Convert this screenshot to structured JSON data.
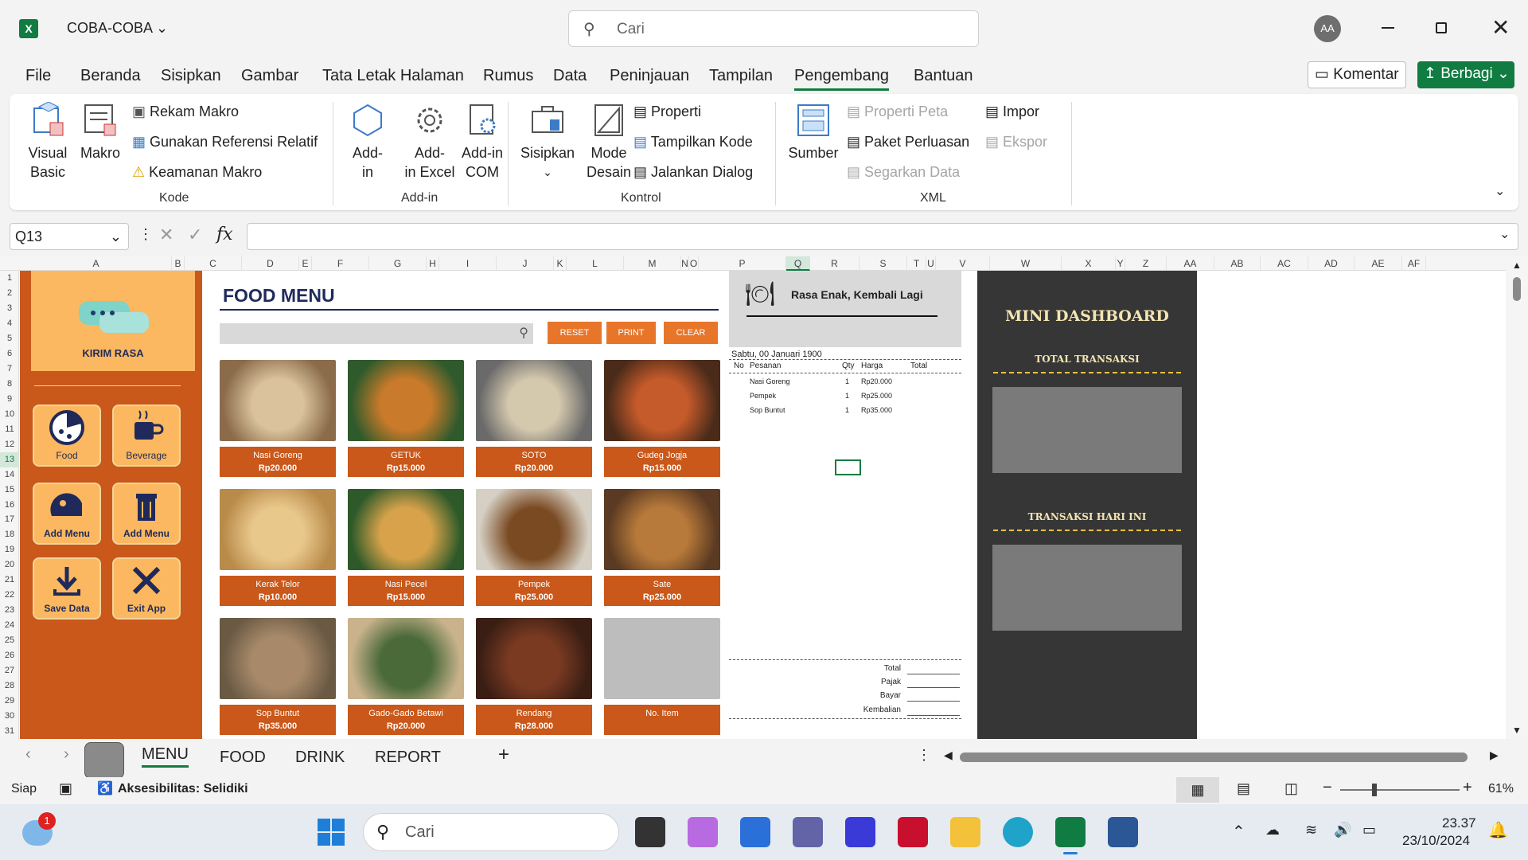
{
  "titlebar": {
    "file_name": "COBA-COBA",
    "search_placeholder": "Cari",
    "avatar": "AA"
  },
  "menu": {
    "tabs": [
      "File",
      "Beranda",
      "Sisipkan",
      "Gambar",
      "Tata Letak Halaman",
      "Rumus",
      "Data",
      "Peninjauan",
      "Tampilan",
      "Pengembang",
      "Bantuan"
    ],
    "active": "Pengembang",
    "comment_btn": "Komentar",
    "share_btn": "Berbagi"
  },
  "ribbon": {
    "kode": {
      "visual_basic": "Visual Basic",
      "visual_basic_1": "Visual",
      "visual_basic_2": "Basic",
      "makro": "Makro",
      "rekam": "Rekam Makro",
      "ref_relatif": "Gunakan Referensi Relatif",
      "keamanan": "Keamanan Makro",
      "label": "Kode"
    },
    "addin": {
      "addin": "Add-in",
      "addin_1": "Add-",
      "addin_2": "in",
      "excel_1": "Add-",
      "excel_2": "in Excel",
      "com_1": "Add-in",
      "com_2": "COM",
      "label": "Add-in"
    },
    "kontrol": {
      "sisipkan": "Sisipkan",
      "mode_1": "Mode",
      "mode_2": "Desain",
      "properti": "Properti",
      "tampilkan_kode": "Tampilkan Kode",
      "jalankan_dialog": "Jalankan Dialog",
      "label": "Kontrol"
    },
    "xml": {
      "sumber": "Sumber",
      "properti_peta": "Properti Peta",
      "paket_perluasan": "Paket Perluasan",
      "segarkan_data": "Segarkan Data",
      "impor": "Impor",
      "ekspor": "Ekspor",
      "label": "XML"
    }
  },
  "formula": {
    "cell_ref": "Q13",
    "value": ""
  },
  "columns": [
    {
      "l": "A",
      "w": 190
    },
    {
      "l": "B",
      "w": 16
    },
    {
      "l": "C",
      "w": 72
    },
    {
      "l": "D",
      "w": 72
    },
    {
      "l": "E",
      "w": 16
    },
    {
      "l": "F",
      "w": 72
    },
    {
      "l": "G",
      "w": 72
    },
    {
      "l": "H",
      "w": 16
    },
    {
      "l": "I",
      "w": 72
    },
    {
      "l": "J",
      "w": 72
    },
    {
      "l": "K",
      "w": 16
    },
    {
      "l": "L",
      "w": 72
    },
    {
      "l": "M",
      "w": 72
    },
    {
      "l": "N",
      "w": 10
    },
    {
      "l": "O",
      "w": 12
    },
    {
      "l": "P",
      "w": 110
    },
    {
      "l": "Q",
      "w": 30
    },
    {
      "l": "R",
      "w": 62
    },
    {
      "l": "S",
      "w": 60
    },
    {
      "l": "T",
      "w": 24
    },
    {
      "l": "U",
      "w": 12
    },
    {
      "l": "V",
      "w": 68
    },
    {
      "l": "W",
      "w": 90
    },
    {
      "l": "X",
      "w": 68
    },
    {
      "l": "Y",
      "w": 12
    },
    {
      "l": "Z",
      "w": 52
    },
    {
      "l": "AA",
      "w": 60
    },
    {
      "l": "AB",
      "w": 58
    },
    {
      "l": "AC",
      "w": 60
    },
    {
      "l": "AD",
      "w": 58
    },
    {
      "l": "AE",
      "w": 60
    },
    {
      "l": "AF",
      "w": 30
    }
  ],
  "rows": [
    "1",
    "2",
    "3",
    "4",
    "5",
    "6",
    "7",
    "8",
    "9",
    "10",
    "11",
    "12",
    "13",
    "14",
    "15",
    "16",
    "17",
    "18",
    "19",
    "20",
    "21",
    "22",
    "23",
    "24",
    "25",
    "26",
    "27",
    "28",
    "29",
    "30",
    "31"
  ],
  "sidebar": {
    "brand": "KIRIM RASA",
    "buttons": [
      {
        "label": "Food",
        "icon": "pizza-icon"
      },
      {
        "label": "Beverage",
        "icon": "coffee-cup-icon"
      },
      {
        "label": "Add Menu",
        "icon": "taco-icon"
      },
      {
        "label": "Add Menu",
        "icon": "trash-icon"
      },
      {
        "label": "Save Data",
        "icon": "download-icon"
      },
      {
        "label": "Exit App",
        "icon": "close-icon"
      }
    ]
  },
  "menu_panel": {
    "title": "FOOD MENU",
    "reset": "RESET",
    "print": "PRINT",
    "clear": "CLEAR"
  },
  "foods": [
    {
      "name": "Nasi Goreng",
      "price": "Rp20.000"
    },
    {
      "name": "GETUK",
      "price": "Rp15.000"
    },
    {
      "name": "SOTO",
      "price": "Rp20.000"
    },
    {
      "name": "Gudeg Jogja",
      "price": "Rp15.000"
    },
    {
      "name": "Kerak Telor",
      "price": "Rp10.000"
    },
    {
      "name": "Nasi Pecel",
      "price": "Rp15.000"
    },
    {
      "name": "Pempek",
      "price": "Rp25.000"
    },
    {
      "name": "Sate",
      "price": "Rp25.000"
    },
    {
      "name": "Sop Buntut",
      "price": "Rp35.000"
    },
    {
      "name": "Gado-Gado Betawi",
      "price": "Rp20.000"
    },
    {
      "name": "Rendang",
      "price": "Rp28.000"
    },
    {
      "name": "No. Item",
      "price": ""
    }
  ],
  "receipt": {
    "slogan": "Rasa Enak, Kembali Lagi",
    "date": "Sabtu, 00 Januari 1900",
    "headers": {
      "no": "No",
      "pesanan": "Pesanan",
      "qty": "Qty",
      "harga": "Harga",
      "total": "Total"
    },
    "items": [
      {
        "name": "Nasi Goreng",
        "qty": "1",
        "price": "Rp20.000"
      },
      {
        "name": "Pempek",
        "qty": "1",
        "price": "Rp25.000"
      },
      {
        "name": "Sop Buntut",
        "qty": "1",
        "price": "Rp35.000"
      }
    ],
    "footer": {
      "total": "Total",
      "pajak": "Pajak",
      "bayar": "Bayar",
      "kembalian": "Kembalian"
    }
  },
  "dashboard": {
    "title": "MINI DASHBOARD",
    "total_transaksi": "TOTAL TRANSAKSI",
    "transaksi_hari_ini": "TRANSAKSI HARI INI"
  },
  "sheets": {
    "tabs": [
      "MENU",
      "FOOD",
      "DRINK",
      "REPORT"
    ],
    "active": "MENU"
  },
  "status": {
    "ready": "Siap",
    "accessibility": "Aksesibilitas: Selidiki",
    "zoom": "61%"
  },
  "taskbar": {
    "search": "Cari",
    "time": "23.37",
    "date": "23/10/2024",
    "notif_badge": "1"
  },
  "colors": {
    "accent_green": "#107c41",
    "sidebar_orange": "#c9581a",
    "button_yellow": "#fbb860",
    "dashboard_dark": "#363636"
  }
}
